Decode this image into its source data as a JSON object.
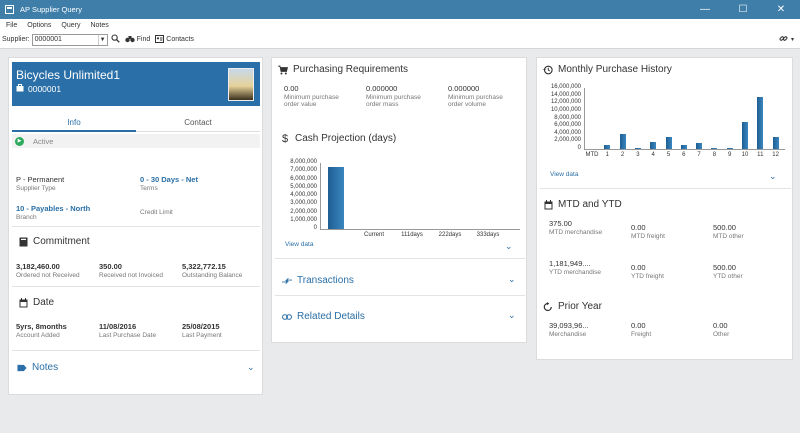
{
  "window": {
    "title": "AP Supplier Query",
    "buttons": [
      "—",
      "☐",
      "✕"
    ]
  },
  "menu": [
    "File",
    "Options",
    "Query",
    "Notes"
  ],
  "toolbar": {
    "supplier_label": "Supplier:",
    "supplier_value": "0000001",
    "find_label": "Find",
    "contacts_label": "Contacts"
  },
  "supplier": {
    "name": "Bicycles Unlimited1",
    "code": "0000001"
  },
  "tabs": [
    "Info",
    "Contact"
  ],
  "status": "Active",
  "info": {
    "supplier_type": {
      "value": "P - Permanent",
      "label": "Supplier Type"
    },
    "terms": {
      "value": "0 - 30 Days - Net",
      "label": "Terms"
    },
    "branch": {
      "value": "10 - Payables - North",
      "label": "Branch"
    },
    "credit_limit": {
      "label": "Credit Limit"
    }
  },
  "commitment": {
    "title": "Commitment",
    "items": [
      {
        "value": "3,182,460.00",
        "label": "Ordered not Received"
      },
      {
        "value": "350.00",
        "label": "Received not Invoiced"
      },
      {
        "value": "5,322,772.15",
        "label": "Outstanding Balance"
      }
    ]
  },
  "date": {
    "title": "Date",
    "items": [
      {
        "value": "5yrs, 8months",
        "label": "Account Added"
      },
      {
        "value": "11/08/2016",
        "label": "Last Purchase Date"
      },
      {
        "value": "25/08/2015",
        "label": "Last Payment"
      }
    ]
  },
  "notes": {
    "title": "Notes"
  },
  "purchasing": {
    "title": "Purchasing Requirements",
    "items": [
      {
        "value": "0.00",
        "label": "Minimum purchase order value"
      },
      {
        "value": "0.000000",
        "label": "Minimum purchase order mass"
      },
      {
        "value": "0.000000",
        "label": "Minimum purchase order volume"
      }
    ]
  },
  "cash_projection": {
    "title": "Cash Projection (days)",
    "view_data": "View data"
  },
  "transactions": {
    "title": "Transactions"
  },
  "related": {
    "title": "Related Details"
  },
  "monthly": {
    "title": "Monthly Purchase History",
    "view_data": "View data"
  },
  "mtd_ytd": {
    "title": "MTD and YTD",
    "items": [
      {
        "value": "375.00",
        "label": "MTD merchandise"
      },
      {
        "value": "0.00",
        "label": "MTD freight"
      },
      {
        "value": "500.00",
        "label": "MTD other"
      },
      {
        "value": "1,181,949....",
        "label": "YTD merchandise"
      },
      {
        "value": "0.00",
        "label": "YTD freight"
      },
      {
        "value": "500.00",
        "label": "YTD other"
      }
    ]
  },
  "prior_year": {
    "title": "Prior Year",
    "items": [
      {
        "value": "39,093,96...",
        "label": "Merchandise"
      },
      {
        "value": "0.00",
        "label": "Freight"
      },
      {
        "value": "0.00",
        "label": "Other"
      }
    ]
  },
  "colors": {
    "accent": "#2a6fa7",
    "titlebar": "#3f7ea9",
    "active": "#2eaa5d"
  },
  "chart_data": [
    {
      "type": "bar",
      "categories": [
        "",
        "Current",
        "111days",
        "222days",
        "333days"
      ],
      "values": [
        7500000,
        0,
        0,
        0,
        0
      ],
      "ylim": [
        0,
        8000000
      ],
      "yticks": [
        "8,000,000",
        "7,000,000",
        "6,000,000",
        "5,000,000",
        "4,000,000",
        "3,000,000",
        "2,000,000",
        "1,000,000",
        "0"
      ]
    },
    {
      "type": "bar",
      "categories": [
        "MTD",
        "1",
        "2",
        "3",
        "4",
        "5",
        "6",
        "7",
        "8",
        "9",
        "10",
        "11",
        "12"
      ],
      "values": [
        0,
        1000000,
        4000000,
        200000,
        1800000,
        3200000,
        1000000,
        1600000,
        300000,
        300000,
        7000000,
        13600000,
        3200000
      ],
      "ylim": [
        0,
        16000000
      ],
      "yticks": [
        "16,000,000",
        "14,000,000",
        "12,000,000",
        "10,000,000",
        "8,000,000",
        "6,000,000",
        "4,000,000",
        "2,000,000",
        "0"
      ]
    }
  ]
}
